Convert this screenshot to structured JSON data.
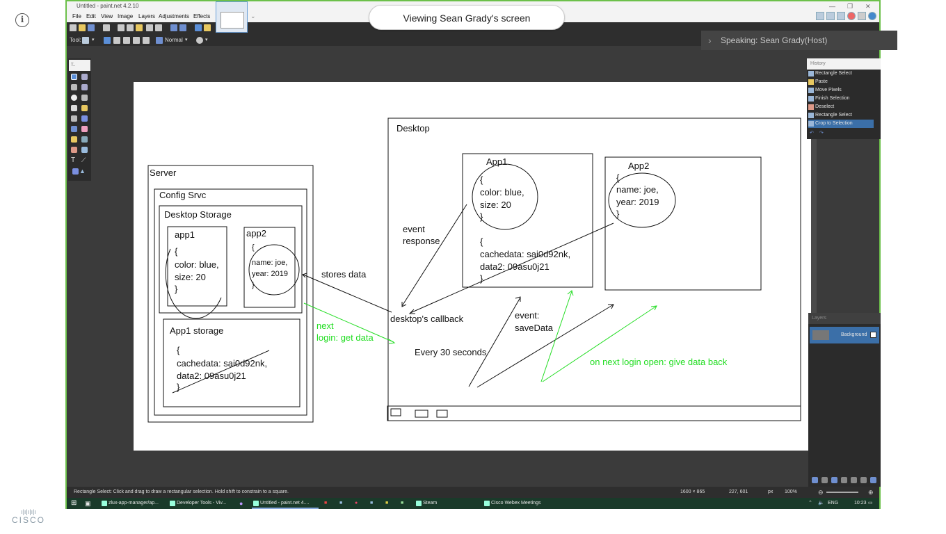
{
  "meeting": {
    "viewing_label": "Viewing Sean Grady's screen",
    "speaking_label": "Speaking: Sean Grady(Host)",
    "brand": "CISCO"
  },
  "app": {
    "title": "Untitled - paint.net 4.2.10",
    "menu": [
      "File",
      "Edit",
      "View",
      "Image",
      "Layers",
      "Adjustments",
      "Effects"
    ],
    "toolbar": {
      "tool_label": "Tool:",
      "blend_mode": "Normal"
    },
    "tools_panel_title": "T..",
    "history": {
      "title": "History",
      "items": [
        "Rectangle Select",
        "Paste",
        "Move Pixels",
        "Finish Selection",
        "Deselect",
        "Rectangle Select",
        "Crop to Selection"
      ],
      "selected_index": 6
    },
    "layers": {
      "title": "Layers",
      "items": [
        {
          "name": "Background",
          "visible": true
        }
      ]
    },
    "status": {
      "hint": "Rectangle Select: Click and drag to draw a rectangular selection. Hold shift to constrain to a square.",
      "image_size": "1600 × 865",
      "cursor_pos": "227, 601",
      "unit": "px",
      "zoom": "100%"
    }
  },
  "taskbar": {
    "items": [
      "zlux-app-manager/ap...",
      "Developer Tools - Viv...",
      "Untitled - paint.net 4....",
      "Steam",
      "Cisco Webex Meetings"
    ],
    "language": "ENG",
    "time": "10:23"
  },
  "diagram": {
    "server": {
      "label": "Server",
      "config_label": "Config Srvc",
      "storage_label": "Desktop Storage",
      "app1": {
        "label": "app1",
        "lines": [
          "{",
          "color: blue,",
          "size: 20",
          "}"
        ]
      },
      "app2": {
        "label": "app2",
        "lines": [
          "{",
          "name: joe,",
          "year: 2019",
          "}"
        ]
      },
      "app1_storage": {
        "label": "App1 storage",
        "lines": [
          "{",
          "cachedata: sai0d92nk,",
          "data2: 09asu0j21",
          "}"
        ]
      }
    },
    "desktop": {
      "label": "Desktop",
      "app1": {
        "label": "App1",
        "circle_lines": [
          "{",
          "color: blue,",
          "size: 20",
          "}"
        ],
        "cache_lines": [
          "{",
          "cachedata: sai0d92nk,",
          "data2: 09asu0j21",
          "}"
        ]
      },
      "app2": {
        "label": "App2",
        "circle_lines": [
          "{",
          "name: joe,",
          "year: 2019",
          "}"
        ]
      }
    },
    "annotations": {
      "event_response": [
        "event",
        "response"
      ],
      "stores_data": "stores data",
      "next_login": [
        "next",
        "login: get data"
      ],
      "desktop_callback": "desktop's callback",
      "event_save": [
        "event:",
        "saveData"
      ],
      "every_30": "Every 30 seconds",
      "give_back": "on next login open: give data back"
    },
    "colors": {
      "ink": "#111111",
      "green": "#22dd22"
    }
  }
}
